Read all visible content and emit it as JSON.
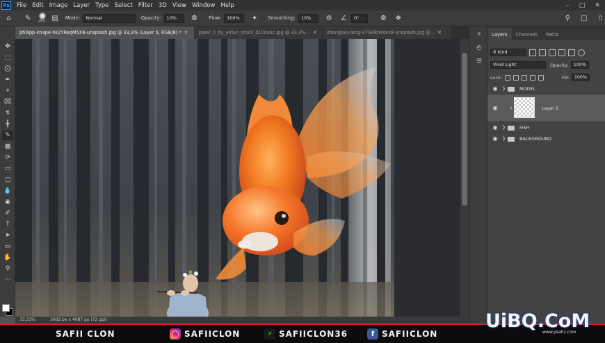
{
  "menu": {
    "logo": "Ps",
    "items": [
      "File",
      "Edit",
      "Image",
      "Layer",
      "Type",
      "Select",
      "Filter",
      "3D",
      "View",
      "Window",
      "Help"
    ]
  },
  "options": {
    "brush_size": "250",
    "mode_label": "Mode:",
    "mode_value": "Normal",
    "opacity_label": "Opacity:",
    "opacity_value": "10%",
    "flow_label": "Flow:",
    "flow_value": "100%",
    "smoothing_label": "Smoothing:",
    "smoothing_value": "10%",
    "angle_value": "0°"
  },
  "tabs": [
    {
      "label": "philipp-knape-hk2YReqM5X8-unsplash.jpg @ 33,3% (Layer 5, RGB/8) *",
      "active": true
    },
    {
      "label": "piper_ii_by_eirian_stock_d10ns6c.jpg @ 33,3%..."
    },
    {
      "label": "zhengtao-tang-V7SKRhXskv8-unsplash.jpg @..."
    }
  ],
  "status": {
    "zoom": "33,33%",
    "doc_size": "3602 px x 4087 px (72 ppi)"
  },
  "panel": {
    "tabs": [
      "Layers",
      "Channels",
      "Paths"
    ],
    "filter_value": "Kind",
    "blend_mode": "Vivid Light",
    "opacity_label": "Opacity:",
    "opacity_value": "100%",
    "lock_label": "Lock:",
    "fill_label": "Fill:",
    "fill_value": "100%",
    "layers": [
      {
        "name": "MODEL",
        "type": "group"
      },
      {
        "name": "Layer 5",
        "type": "layer"
      },
      {
        "name": "FISH",
        "type": "group"
      },
      {
        "name": "BACKGROUND",
        "type": "group"
      }
    ]
  },
  "banner": {
    "name": "SAFII CLON",
    "instagram": "SAFIICLON",
    "handle2": "SAFIICLON36",
    "facebook": "SAFIICLON"
  },
  "watermark": {
    "main": "UiBQ.CoM",
    "sub": "www.psahz.com"
  },
  "colors": {
    "accent_red": "#d3232a",
    "ps_blue": "#31a8ff",
    "fish_orange": "#f0701e"
  }
}
